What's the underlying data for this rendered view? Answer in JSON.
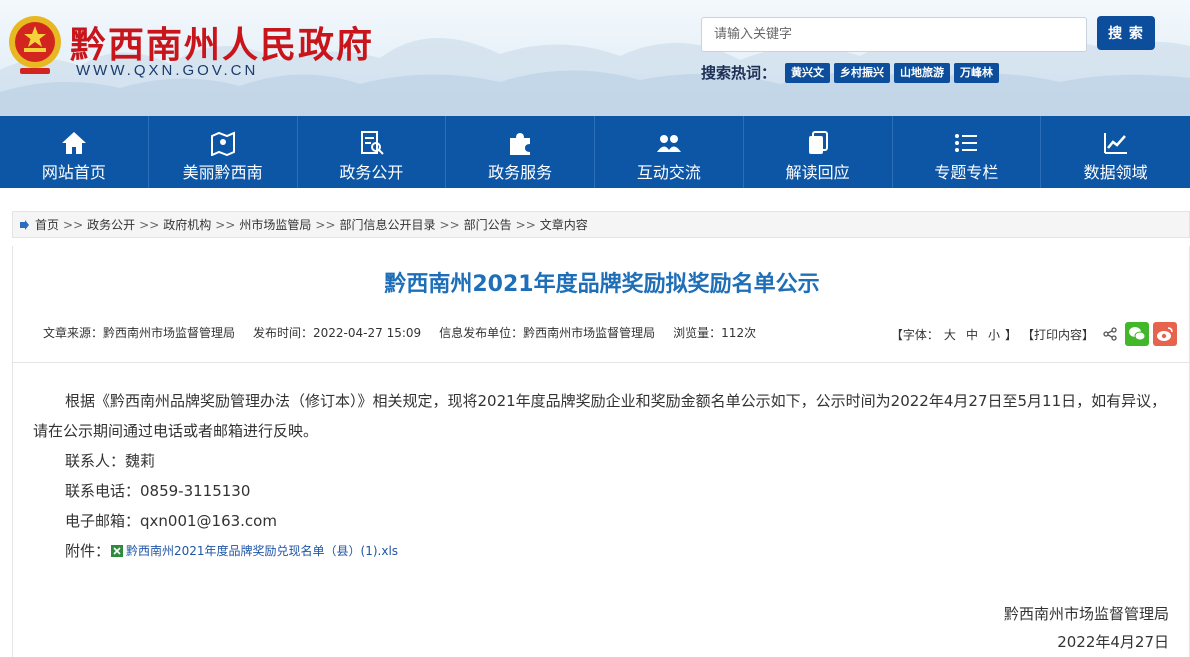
{
  "header": {
    "site_title": "黔西南州人民政府",
    "site_url": "WWW.QXN.GOV.CN",
    "search_placeholder": "请输入关键字",
    "search_button": "搜 索",
    "hot_label": "搜索热词：",
    "hot_tags": [
      "黄兴文",
      "乡村振兴",
      "山地旅游",
      "万峰林"
    ]
  },
  "nav": [
    {
      "label": "网站首页",
      "icon": "home-icon"
    },
    {
      "label": "美丽黔西南",
      "icon": "map-icon"
    },
    {
      "label": "政务公开",
      "icon": "document-search-icon"
    },
    {
      "label": "政务服务",
      "icon": "puzzle-icon"
    },
    {
      "label": "互动交流",
      "icon": "people-icon"
    },
    {
      "label": "解读回应",
      "icon": "files-icon"
    },
    {
      "label": "专题专栏",
      "icon": "list-icon"
    },
    {
      "label": "数据领域",
      "icon": "chart-icon"
    }
  ],
  "breadcrumb": {
    "items": [
      "首页",
      "政务公开",
      "政府机构",
      "州市场监管局",
      "部门信息公开目录",
      "部门公告",
      "文章内容"
    ],
    "separator": ">>"
  },
  "article": {
    "title": "黔西南州2021年度品牌奖励拟奖励名单公示",
    "meta": {
      "source": "文章来源：黔西南州市场监督管理局",
      "time": "发布时间：2022-04-27 15:09",
      "publisher": "信息发布单位：黔西南州市场监督管理局",
      "views": "浏览量：112次"
    },
    "tools": {
      "font_prefix": "【字体：",
      "font_large": "大",
      "font_medium": "中",
      "font_small": "小",
      "font_suffix": "】",
      "print": "【打印内容】"
    },
    "body": "根据《黔西南州品牌奖励管理办法（修订本）》相关规定，现将2021年度品牌奖励企业和奖励金额名单公示如下，公示时间为2022年4月27日至5月11日，如有异议，请在公示期间通过电话或者邮箱进行反映。",
    "contact": "联系人：魏莉",
    "phone": "联系电话：0859-3115130",
    "email": "电子邮箱：qxn001@163.com",
    "attachment_label": "附件：",
    "attachment_name": "黔西南州2021年度品牌奖励兑现名单（县）(1).xls",
    "signature_org": "黔西南州市场监督管理局",
    "signature_date": "2022年4月27日"
  },
  "colors": {
    "nav_bg": "#0d56a6",
    "title_blue": "#1f6fb8",
    "brand_red": "#c8151b"
  }
}
